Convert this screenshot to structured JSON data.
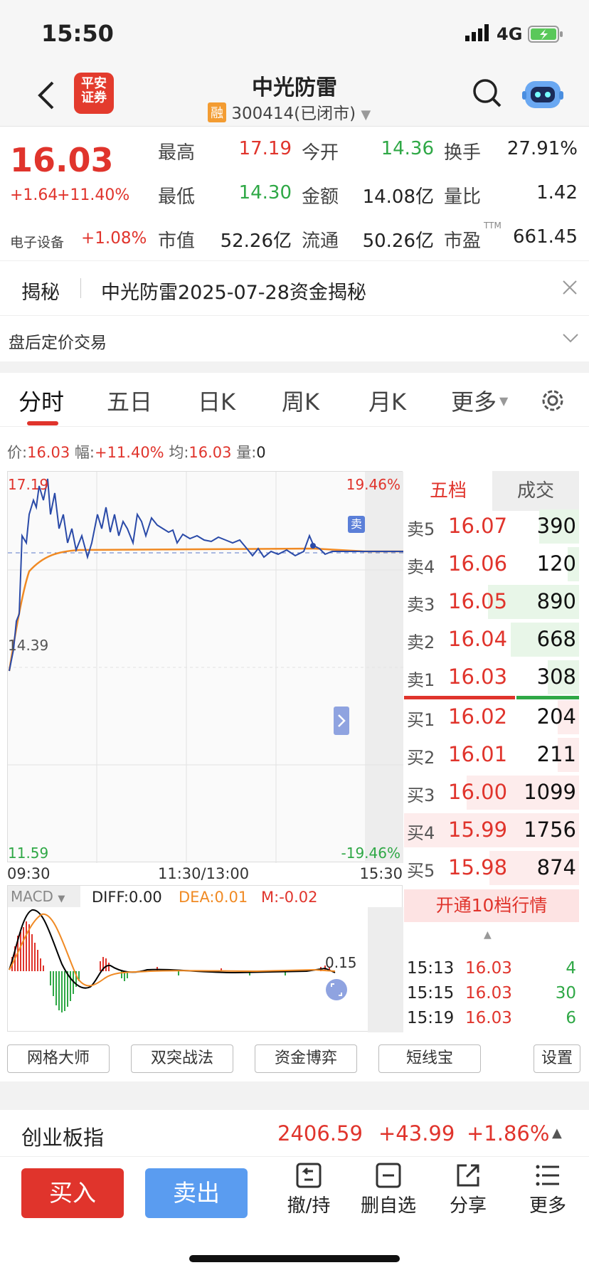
{
  "status": {
    "time": "15:50",
    "network": "4G"
  },
  "header": {
    "stock_name": "中光防雷",
    "margin_tag": "融",
    "code_status": "300414(已闭市)",
    "logo_line1": "平安",
    "logo_line2": "证券"
  },
  "quote": {
    "price": "16.03",
    "change": "+1.64",
    "change_pct": "+11.40%",
    "sector": "电子设备",
    "sector_pct": "+1.08%",
    "fields": [
      {
        "label": "最高",
        "value": "17.19"
      },
      {
        "label": "今开",
        "value": "14.36"
      },
      {
        "label": "换手",
        "value": "27.91%"
      },
      {
        "label": "最低",
        "value": "14.30"
      },
      {
        "label": "金额",
        "value": "14.08亿"
      },
      {
        "label": "量比",
        "value": "1.42"
      },
      {
        "label": "市值",
        "value": "52.26亿"
      },
      {
        "label": "流通",
        "value": "50.26亿"
      },
      {
        "label": "市盈",
        "value": "661.45"
      }
    ],
    "ttm": "TTM"
  },
  "banner": {
    "tag": "揭秘",
    "text": "中光防雷2025-07-28资金揭秘"
  },
  "after_hours": "盘后定价交易",
  "tabs": [
    "分时",
    "五日",
    "日K",
    "周K",
    "月K",
    "更多"
  ],
  "info_line": {
    "price_label": "价:",
    "price": "16.03",
    "amp_label": "幅:",
    "amp": "+11.40%",
    "avg_label": "均:",
    "avg": "16.03",
    "vol_label": "量:",
    "vol": "0"
  },
  "chart": {
    "high": "17.19",
    "mid": "14.39",
    "low": "11.59",
    "up_pct": "19.46%",
    "down_pct": "-19.46%",
    "t_start": "09:30",
    "t_mid": "11:30/13:00",
    "t_end": "15:30",
    "sell_marker": "卖"
  },
  "macd": {
    "label": "MACD",
    "diff": "DIFF:0.00",
    "dea": "DEA:0.01",
    "m": "M:-0.02",
    "scale": "0.15"
  },
  "orderbook": {
    "tab_active": "五档",
    "tab_other": "成交",
    "asks": [
      {
        "label": "卖5",
        "price": "16.07",
        "vol": "390"
      },
      {
        "label": "卖4",
        "price": "16.06",
        "vol": "120"
      },
      {
        "label": "卖3",
        "price": "16.05",
        "vol": "890"
      },
      {
        "label": "卖2",
        "price": "16.04",
        "vol": "668"
      },
      {
        "label": "卖1",
        "price": "16.03",
        "vol": "308"
      }
    ],
    "bids": [
      {
        "label": "买1",
        "price": "16.02",
        "vol": "204"
      },
      {
        "label": "买2",
        "price": "16.01",
        "vol": "211"
      },
      {
        "label": "买3",
        "price": "16.00",
        "vol": "1099"
      },
      {
        "label": "买4",
        "price": "15.99",
        "vol": "1756"
      },
      {
        "label": "买5",
        "price": "15.98",
        "vol": "874"
      }
    ],
    "promo": "开通10档行情"
  },
  "ticks": [
    {
      "time": "15:13",
      "price": "16.03",
      "vol": "4"
    },
    {
      "time": "15:15",
      "price": "16.03",
      "vol": "30"
    },
    {
      "time": "15:19",
      "price": "16.03",
      "vol": "6"
    }
  ],
  "tools": [
    "网格大师",
    "双突战法",
    "资金博弈",
    "短线宝",
    "设置"
  ],
  "index": {
    "name": "创业板指",
    "value": "2406.59",
    "change": "+43.99",
    "pct": "+1.86%"
  },
  "actions": {
    "buy": "买入",
    "sell": "卖出",
    "withdraw": "撤/持",
    "remove": "删自选",
    "share": "分享",
    "more": "更多"
  }
}
